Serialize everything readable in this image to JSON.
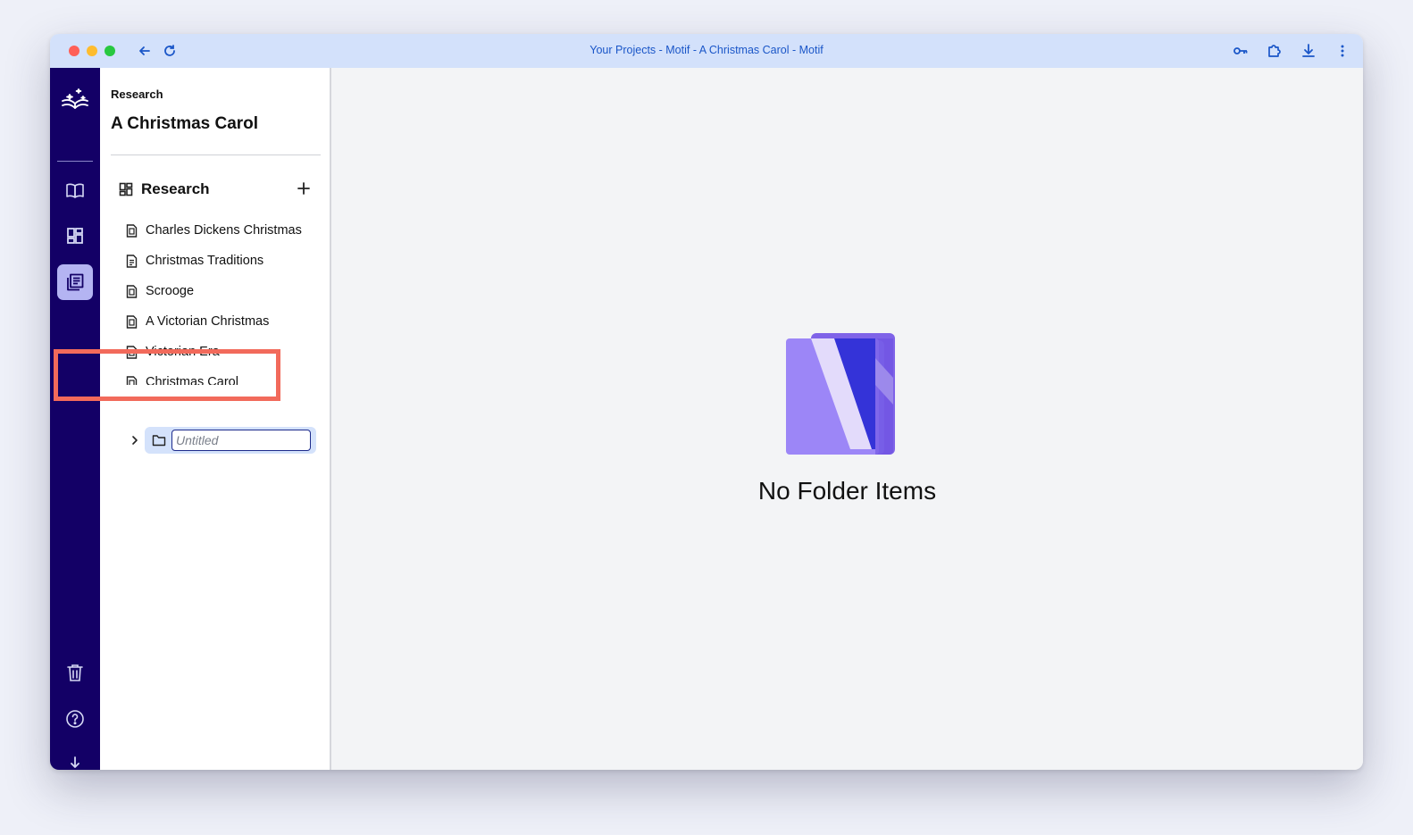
{
  "browser": {
    "title": "Your Projects - Motif - A Christmas Carol - Motif",
    "icons": {
      "back": "arrow-left-icon",
      "reload": "reload-icon",
      "key": "key-icon",
      "extensions": "puzzle-icon",
      "download": "download-icon",
      "menu": "more-vertical-icon"
    }
  },
  "rail": {
    "items": [
      {
        "name": "book-icon",
        "active": false
      },
      {
        "name": "dashboard-icon",
        "active": false
      },
      {
        "name": "research-icon",
        "active": true
      }
    ],
    "bottom": [
      "trash-icon",
      "help-icon",
      "download-icon"
    ]
  },
  "panel": {
    "breadcrumb": "Research",
    "project_title": "A Christmas Carol",
    "section_label": "Research",
    "items": [
      {
        "label": "Charles Dickens Christmas",
        "icon": "document-icon"
      },
      {
        "label": "Christmas Traditions",
        "icon": "text-document-icon"
      },
      {
        "label": "Scrooge",
        "icon": "document-icon"
      },
      {
        "label": "A Victorian Christmas",
        "icon": "document-icon"
      },
      {
        "label": "Victorian Era",
        "icon": "document-icon"
      },
      {
        "label": "Christmas Carol",
        "icon": "document-icon"
      }
    ],
    "new_folder": {
      "placeholder": "Untitled",
      "value": ""
    }
  },
  "main": {
    "empty_text": "No Folder Items"
  },
  "colors": {
    "titlebar": "#d3e1fb",
    "rail": "#130066",
    "rail_active": "#b4b4f2",
    "highlight": "#f26a5b",
    "accent": "#1a56c8"
  }
}
